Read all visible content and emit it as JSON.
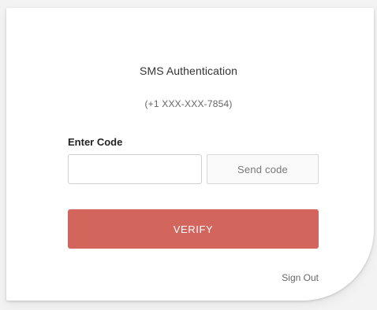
{
  "auth": {
    "title": "SMS Authentication",
    "phone_masked": "(+1 XXX-XXX-7854)",
    "code_label": "Enter Code",
    "code_value": "",
    "code_placeholder": "",
    "send_code_label": "Send code",
    "verify_label": "VERIFY",
    "sign_out_label": "Sign Out"
  },
  "colors": {
    "accent": "#d3665c",
    "card_background": "#ffffff",
    "page_background": "#f3f3f3"
  }
}
